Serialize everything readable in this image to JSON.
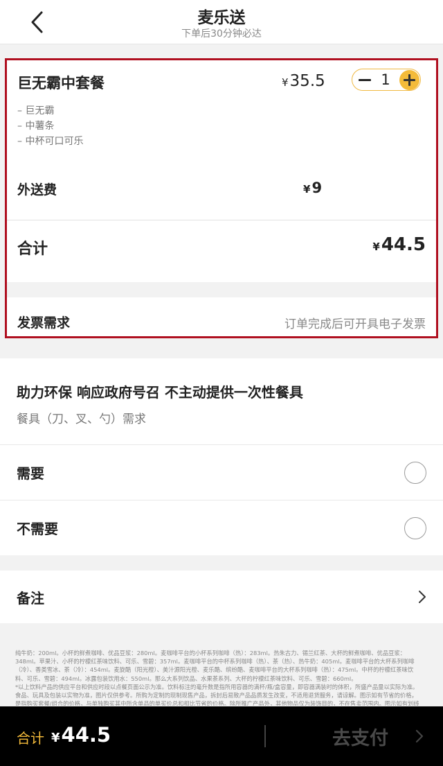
{
  "header": {
    "title": "麦乐送",
    "subtitle": "下单后30分钟必达"
  },
  "order": {
    "item_name": "巨无霸中套餐",
    "currency": "¥",
    "item_price": "35.5",
    "quantity": "1",
    "components": [
      "– 巨无霸",
      "– 中薯条",
      "– 中杯可口可乐"
    ],
    "delivery_label": "外送费",
    "delivery_price": "9",
    "total_label": "合计",
    "total_price": "44.5",
    "invoice_label": "发票需求",
    "invoice_note": "订单完成后可开具电子发票"
  },
  "eco": {
    "title": "助力环保 响应政府号召 不主动提供一次性餐具",
    "subtitle": "餐具（刀、叉、勺）需求"
  },
  "options": {
    "need": "需要",
    "no_need": "不需要"
  },
  "remarks": {
    "label": "备注"
  },
  "disclaimer": [
    "纯牛奶：200ml。小杯的鲜煮咖啡、优品豆浆：280ml。麦咖啡平台的小杯系列咖啡（热）：283ml。热朱古力、锡兰红茶、大杯的鲜煮咖啡、优品豆浆：",
    "348ml。苹果汁、小杯的柠檬红茶味饮料、可乐、雪碧：357ml。麦咖啡平台的中杯系列咖啡（热）、茶（热）、热牛奶：405ml。麦咖啡平台的大杯系列咖啡",
    "（冷）、香类雪冰、茶（冷）：454ml。麦旋酷（阳光橙）、美汁源阳光橙、麦乐酷、缤纷酷、麦咖啡平台的大杯系列咖啡（热）：475ml。中杯的柠檬红茶味饮",
    "料、可乐、雪碧：494ml。冰露包装饮用水：550ml。那么大系列饮品、水果茶系列、大杯的柠檬红茶味饮料、可乐、雪碧：660ml。",
    "*以上饮料产品的供应平台和供应时段以点餐页面公示为准。饮料标注的毫升数是指所用容器的满杯/瓶/盒容量，即容器满装时的体积，所盛产品量以实际为准。",
    "食品、玩具及包装以实物为准，图片仅供参考。所购为定制的现制现售产品，拆封后易致产品品质发生改变，不适用退货服务，请谅解。图示如有节省的价格，",
    "是指购买套餐/组合的价格，与单独购买其中所含单品的单买价总和相比节省的价格。除所推广产品外，其他物品仅为装饰目的，不在售卖范围内。图示如有划线"
  ],
  "bottom_bar": {
    "total_label": "合计",
    "currency": "¥",
    "total": "44.5",
    "pay_label": "去支付"
  },
  "colors": {
    "accent": "#f4bb3a",
    "highlight_border": "#b01020",
    "background": "#f2f2f2",
    "bottom_bar": "#000000"
  },
  "icons": [
    "back-arrow-icon",
    "minus-icon",
    "plus-icon",
    "radio-icon",
    "chevron-right-icon"
  ]
}
